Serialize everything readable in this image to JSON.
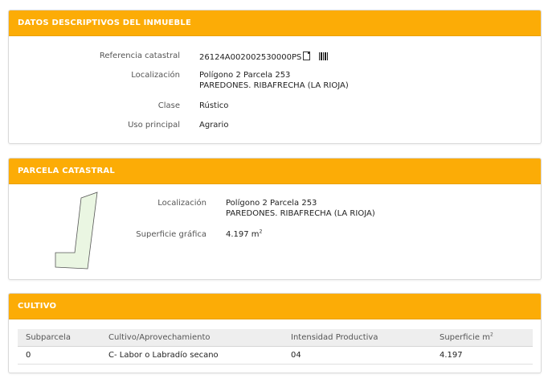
{
  "datos": {
    "header": "DATOS DESCRIPTIVOS DEL INMUEBLE",
    "referencia_label": "Referencia catastral",
    "referencia_value": "26124A002002530000PS",
    "localizacion_label": "Localización",
    "localizacion_line1": "Polígono 2 Parcela 253",
    "localizacion_line2": "PAREDONES. RIBAFRECHA (LA RIOJA)",
    "clase_label": "Clase",
    "clase_value": "Rústico",
    "uso_label": "Uso principal",
    "uso_value": "Agrario"
  },
  "parcela": {
    "header": "PARCELA CATASTRAL",
    "localizacion_label": "Localización",
    "localizacion_line1": "Polígono 2 Parcela 253",
    "localizacion_line2": "PAREDONES. RIBAFRECHA (LA RIOJA)",
    "superficie_label": "Superficie gráfica",
    "superficie_value": "4.197 m",
    "superficie_unit_exp": "2"
  },
  "cultivo": {
    "header": "CULTIVO",
    "columns": {
      "subparcela": "Subparcela",
      "cultivo": "Cultivo/Aprovechamiento",
      "intensidad": "Intensidad Productiva",
      "superficie": "Superficie m",
      "superficie_exp": "2"
    },
    "rows": [
      {
        "subparcela": "0",
        "cultivo": "C- Labor o Labradío secano",
        "intensidad": "04",
        "superficie": "4.197"
      }
    ]
  },
  "icons": {
    "document": "document-icon",
    "barcode": "barcode-icon"
  },
  "colors": {
    "header_bg": "#fcac06",
    "parcel_fill": "#e8f5e0"
  }
}
